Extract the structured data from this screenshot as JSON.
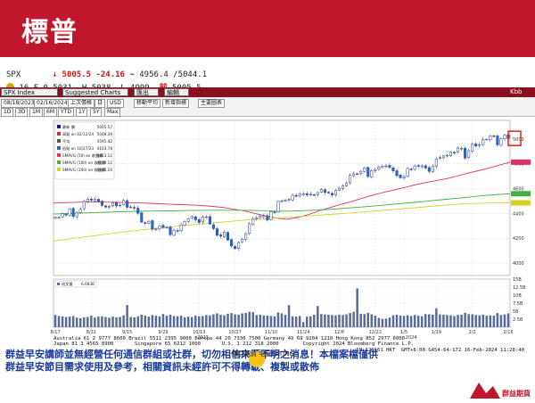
{
  "header": {
    "title": "標普",
    "bg_color": "#c0172c"
  },
  "quote": {
    "ticker": "SPX",
    "last": "5005.5",
    "change": "-24.16",
    "hilo": "4956.4 /5044.1",
    "line2_left": "16 F 0 5031. H 5038. L 4999.",
    "prev_label": "前",
    "prev_value": "5005.5"
  },
  "toolbar": {
    "index_label": "SPX Index",
    "suggested": "Suggested Charts",
    "action1": "匯出",
    "action2": "編輯",
    "icon_label": "Kbb"
  },
  "controls": {
    "date_from": "08/18/2023",
    "date_to": "02/16/2024",
    "last_price": "上次價格",
    "period": "日",
    "currency": "USD",
    "option1": "移動平均",
    "option2": "新增指標",
    "option3": "主要圖表",
    "ranges": [
      "1D",
      "3D",
      "1M",
      "6M",
      "YTD",
      "1Y",
      "5Y",
      "Max"
    ]
  },
  "legend": [
    {
      "label": "最新 價",
      "value": "5005.57",
      "color": "#1a1a8a"
    },
    {
      "label": "高點 on 02/12/24",
      "value": "5048.39",
      "color": "#c83030"
    },
    {
      "label": "平均",
      "value": "4591.42",
      "color": "#555555"
    },
    {
      "label": "低點 on 10/27/23",
      "value": "4103.78",
      "color": "#3060c0"
    },
    {
      "label": "SMAVG (50) on 收盤價",
      "value": "4813.12",
      "color": "#e03070"
    },
    {
      "label": "SMAVG (100) on 收盤價",
      "value": "4559.12",
      "color": "#40b040"
    },
    {
      "label": "SMAVG (200) on 收盤價",
      "value": "4485.10",
      "color": "#d8d020"
    }
  ],
  "volume_legend": {
    "label": "成交量",
    "value": "6.683B"
  },
  "chart_data": {
    "type": "candlestick",
    "title": "SPX Index",
    "price_ylim": [
      3900,
      5150
    ],
    "price_ticks": [
      4000,
      4200,
      4400,
      4600,
      4800,
      5000
    ],
    "volume_ylim": [
      0,
      15
    ],
    "volume_ticks": [
      "2.5B",
      "5B",
      "7.5B",
      "10B",
      "12.5B",
      "15B"
    ],
    "x_ticks": [
      "8/17",
      "8/31",
      "9/15",
      "9/29",
      "10/13",
      "10/27",
      "11/10",
      "11/24",
      "12/8",
      "12/22",
      "1/5",
      "1/19",
      "2/2",
      "2/16"
    ],
    "x_year_labels": [
      "2023",
      "2024"
    ],
    "dates": [
      "8/17",
      "8/18",
      "8/21",
      "8/22",
      "8/23",
      "8/24",
      "8/25",
      "8/28",
      "8/29",
      "8/30",
      "8/31",
      "9/1",
      "9/5",
      "9/6",
      "9/7",
      "9/8",
      "9/11",
      "9/12",
      "9/13",
      "9/14",
      "9/15",
      "9/18",
      "9/19",
      "9/20",
      "9/21",
      "9/22",
      "9/25",
      "9/26",
      "9/27",
      "9/28",
      "9/29",
      "10/2",
      "10/3",
      "10/4",
      "10/5",
      "10/6",
      "10/9",
      "10/10",
      "10/11",
      "10/12",
      "10/13",
      "10/16",
      "10/17",
      "10/18",
      "10/19",
      "10/20",
      "10/23",
      "10/24",
      "10/25",
      "10/26",
      "10/27",
      "10/30",
      "10/31",
      "11/1",
      "11/2",
      "11/3",
      "11/6",
      "11/7",
      "11/8",
      "11/9",
      "11/10",
      "11/13",
      "11/14",
      "11/15",
      "11/16",
      "11/17",
      "11/20",
      "11/21",
      "11/22",
      "11/24",
      "11/27",
      "11/28",
      "11/29",
      "11/30",
      "12/1",
      "12/4",
      "12/5",
      "12/6",
      "12/7",
      "12/8",
      "12/11",
      "12/12",
      "12/13",
      "12/14",
      "12/15",
      "12/18",
      "12/19",
      "12/20",
      "12/21",
      "12/22",
      "12/26",
      "12/27",
      "12/28",
      "12/29",
      "1/2",
      "1/3",
      "1/4",
      "1/5",
      "1/8",
      "1/9",
      "1/10",
      "1/11",
      "1/12",
      "1/16",
      "1/17",
      "1/18",
      "1/19",
      "1/22",
      "1/23",
      "1/24",
      "1/25",
      "1/26",
      "1/29",
      "1/30",
      "1/31",
      "2/1",
      "2/2",
      "2/5",
      "2/6",
      "2/7",
      "2/8",
      "2/9",
      "2/12",
      "2/13",
      "2/14",
      "2/15",
      "2/16"
    ],
    "closes": [
      4370,
      4369,
      4399,
      4387,
      4436,
      4376,
      4405,
      4433,
      4497,
      4514,
      4507,
      4515,
      4496,
      4465,
      4451,
      4457,
      4487,
      4461,
      4467,
      4505,
      4450,
      4453,
      4443,
      4402,
      4330,
      4320,
      4337,
      4273,
      4274,
      4299,
      4288,
      4288,
      4229,
      4263,
      4258,
      4308,
      4335,
      4358,
      4376,
      4349,
      4327,
      4373,
      4373,
      4314,
      4278,
      4224,
      4217,
      4247,
      4186,
      4137,
      4117,
      4166,
      4193,
      4237,
      4317,
      4358,
      4365,
      4378,
      4382,
      4347,
      4415,
      4411,
      4496,
      4502,
      4508,
      4514,
      4547,
      4538,
      4556,
      4559,
      4550,
      4554,
      4550,
      4568,
      4594,
      4569,
      4567,
      4549,
      4585,
      4604,
      4622,
      4643,
      4707,
      4719,
      4719,
      4740,
      4768,
      4698,
      4746,
      4754,
      4774,
      4781,
      4783,
      4770,
      4743,
      4705,
      4688,
      4697,
      4763,
      4756,
      4783,
      4780,
      4784,
      4766,
      4739,
      4780,
      4840,
      4850,
      4864,
      4869,
      4894,
      4891,
      4928,
      4925,
      4846,
      4906,
      4959,
      4943,
      4954,
      4995,
      4998,
      5026,
      5022,
      4953,
      5001,
      5030,
      5005
    ],
    "volumes": [
      3.8,
      3.5,
      3.4,
      3.2,
      3.3,
      3.5,
      3.0,
      2.8,
      3.1,
      3.2,
      3.6,
      3.0,
      3.3,
      3.4,
      3.2,
      3.0,
      3.3,
      3.1,
      3.2,
      3.7,
      6.9,
      3.2,
      3.1,
      3.4,
      3.9,
      3.6,
      3.3,
      3.8,
      3.6,
      3.4,
      4.1,
      3.6,
      3.9,
      3.5,
      3.4,
      3.6,
      3.1,
      3.3,
      3.2,
      3.6,
      3.4,
      3.5,
      3.8,
      3.7,
      4.0,
      4.3,
      3.9,
      3.7,
      4.2,
      4.4,
      4.0,
      3.9,
      4.3,
      4.5,
      4.8,
      4.7,
      3.8,
      3.9,
      3.7,
      3.6,
      3.5,
      3.4,
      4.6,
      4.3,
      3.9,
      6.9,
      3.4,
      3.3,
      3.5,
      1.6,
      3.3,
      3.4,
      3.9,
      6.6,
      4.1,
      4.0,
      3.9,
      3.8,
      3.7,
      3.9,
      3.8,
      4.0,
      4.4,
      4.8,
      12.1,
      4.2,
      4.1,
      4.5,
      4.0,
      3.6,
      2.9,
      2.6,
      2.7,
      3.0,
      3.7,
      3.9,
      3.6,
      3.5,
      3.7,
      3.5,
      3.8,
      3.6,
      3.4,
      4.1,
      4.0,
      3.9,
      5.9,
      4.0,
      3.9,
      3.8,
      3.7,
      3.5,
      3.8,
      3.9,
      4.5,
      4.1,
      4.0,
      3.8,
      3.7,
      3.9,
      3.6,
      3.7,
      3.6,
      4.4,
      3.8,
      4.0,
      4.3
    ],
    "series": [
      {
        "name": "SMAVG (50) on 收盤價",
        "color": "#e03070",
        "y": [
          4483,
          4487,
          4490,
          4492,
          4492,
          4491,
          4489,
          4487,
          4485,
          4482,
          4478,
          4474,
          4471,
          4468,
          4463,
          4457,
          4448,
          4434,
          4420,
          4400,
          4380,
          4362,
          4353,
          4367,
          4391,
          4421,
          4447,
          4472,
          4494,
          4521,
          4546,
          4568,
          4588,
          4607,
          4629,
          4648,
          4664,
          4680,
          4701,
          4724,
          4744,
          4765,
          4790,
          4813
        ]
      },
      {
        "name": "SMAVG (100) on 收盤價",
        "color": "#40b040",
        "y": [
          4395,
          4398,
          4401,
          4404,
          4407,
          4410,
          4413,
          4415,
          4417,
          4419,
          4420,
          4421,
          4423,
          4424,
          4425,
          4426,
          4426,
          4426,
          4425,
          4424,
          4422,
          4419,
          4419,
          4421,
          4424,
          4428,
          4433,
          4439,
          4445,
          4452,
          4459,
          4466,
          4474,
          4482,
          4489,
          4498,
          4506,
          4514,
          4522,
          4531,
          4540,
          4548,
          4554,
          4559
        ]
      },
      {
        "name": "SMAVG (200) on 收盤價",
        "color": "#d8d020",
        "y": [
          4178,
          4189,
          4200,
          4211,
          4222,
          4233,
          4244,
          4254,
          4264,
          4273,
          4282,
          4291,
          4300,
          4308,
          4316,
          4324,
          4332,
          4339,
          4346,
          4352,
          4358,
          4363,
          4368,
          4374,
          4380,
          4386,
          4392,
          4398,
          4404,
          4411,
          4418,
          4425,
          4432,
          4439,
          4446,
          4453,
          4460,
          4467,
          4474,
          4480,
          4482,
          4484,
          4485,
          4485
        ]
      }
    ]
  },
  "footnote": {
    "line1": "Australia 61 2 9777 8600 Brazil 5511 2395 9000 Europe 44 20 7330 7500 Germany 49 69 9204 1210 Hong Kong 852 2977 6000",
    "line2": "Japan 81 3 4565 8900       Singapore 65 6212 1000       U.S. 1 212 318 2000        Copyright 2024 Bloomberg Finance L.P.",
    "line3": "SN 126661 HKT  GMT+8:00 G454-64-172 16-Feb-2024 11:28:40"
  },
  "logo": {
    "text": "群益期貨 宅庭EATING"
  },
  "disclaimer": {
    "line1": "群益早安講師並無經營任何通信群組或社群，切勿相信來源不明之消息！本檔案檔僅供",
    "line2": "群益早安節目需求使用及參考，相關資訊未經許可不得轉載、複製或散佈"
  },
  "blog_url": "https://eting1688.pixnet.net/album",
  "corner_logo": {
    "text": "群益期貨"
  }
}
